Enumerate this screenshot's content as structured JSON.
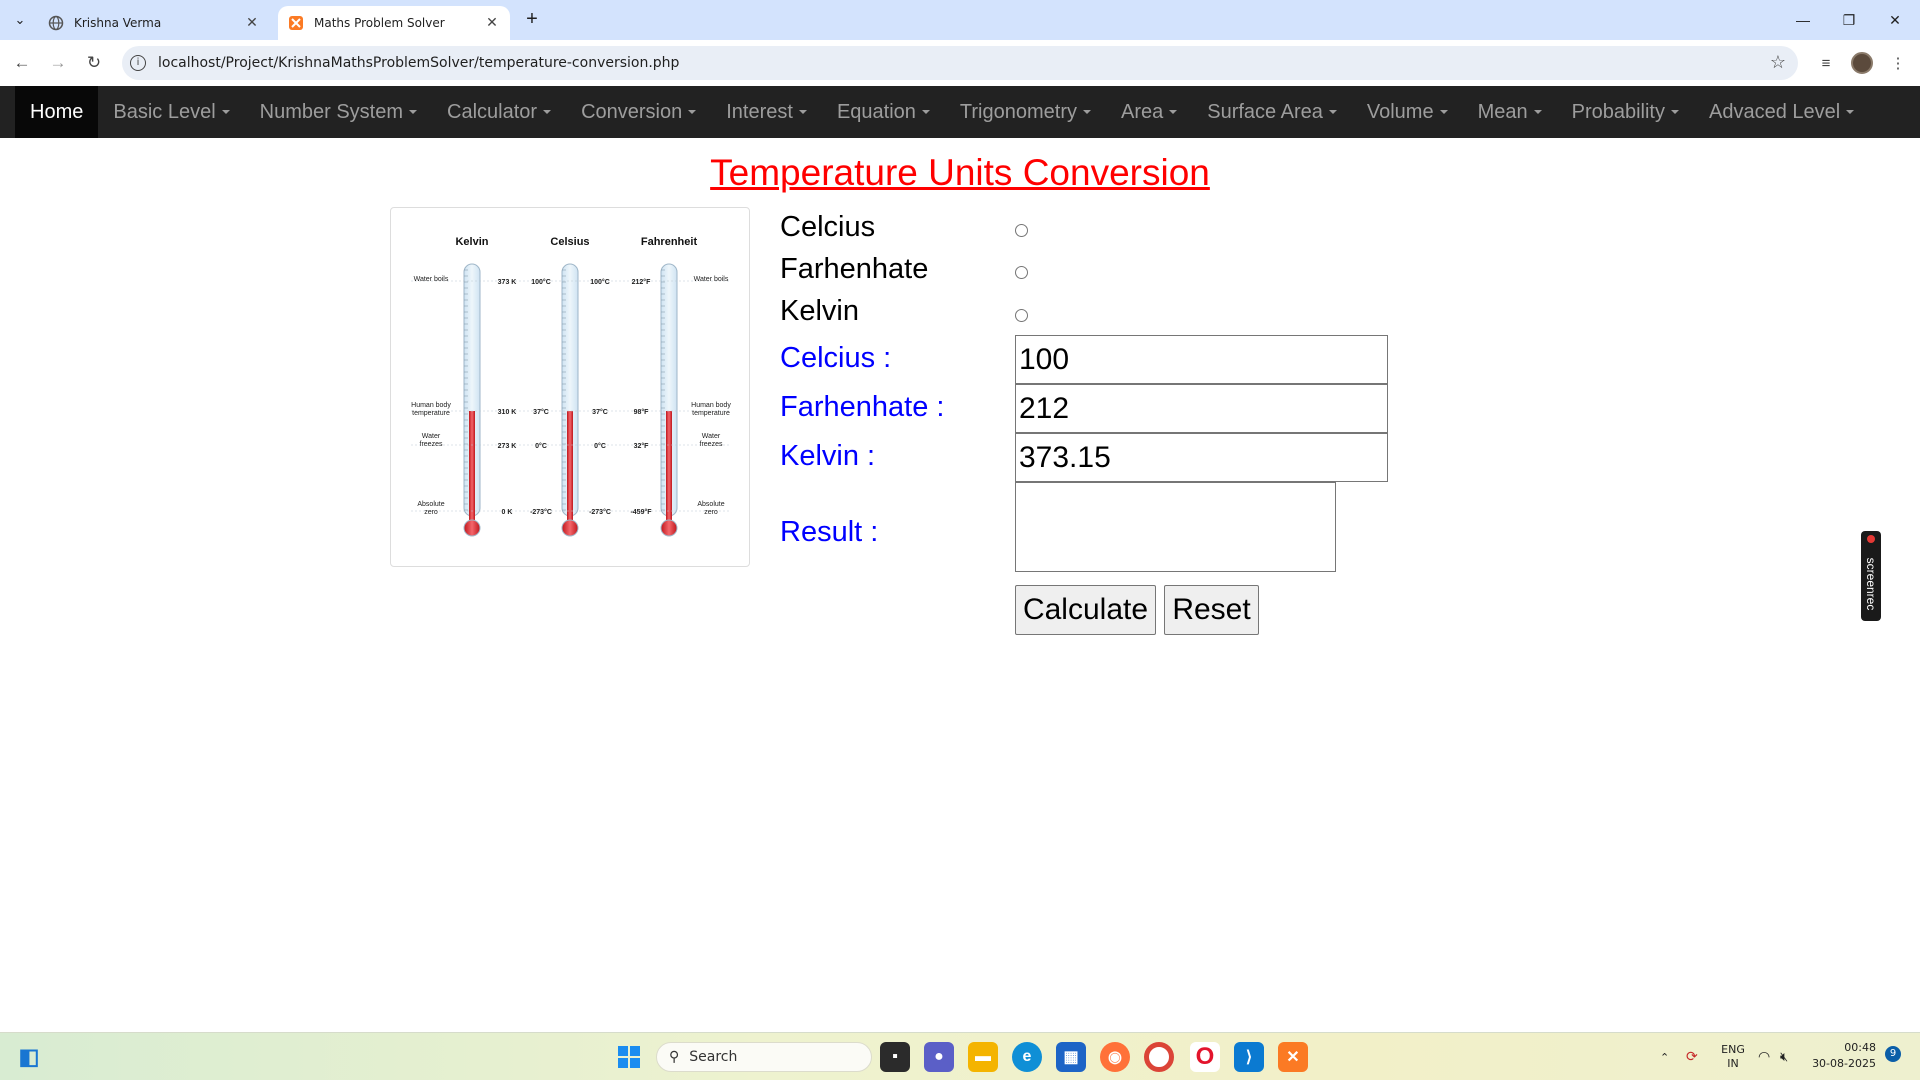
{
  "browser": {
    "tabs": [
      {
        "title": "Krishna Verma",
        "icon": "globe-icon"
      },
      {
        "title": "Maths Problem Solver",
        "icon": "xampp-icon"
      }
    ],
    "url": "localhost/Project/KrishnaMathsProblemSolver/temperature-conversion.php"
  },
  "nav": {
    "items": [
      {
        "label": "Home",
        "caret": false
      },
      {
        "label": "Basic Level",
        "caret": true
      },
      {
        "label": "Number System",
        "caret": true
      },
      {
        "label": "Calculator",
        "caret": true
      },
      {
        "label": "Conversion",
        "caret": true
      },
      {
        "label": "Interest",
        "caret": true
      },
      {
        "label": "Equation",
        "caret": true
      },
      {
        "label": "Trigonometry",
        "caret": true
      },
      {
        "label": "Area",
        "caret": true
      },
      {
        "label": "Surface Area",
        "caret": true
      },
      {
        "label": "Volume",
        "caret": true
      },
      {
        "label": "Mean",
        "caret": true
      },
      {
        "label": "Probability",
        "caret": true
      },
      {
        "label": "Advaced Level",
        "caret": true
      }
    ]
  },
  "page": {
    "title": "Temperature Units Conversion",
    "radio_labels": [
      "Celcius",
      "Farhenhate",
      "Kelvin"
    ],
    "fields": {
      "celsius_label": "Celcius :",
      "celsius_value": "100",
      "fahrenheit_label": "Farhenhate :",
      "fahrenheit_value": "212",
      "kelvin_label": "Kelvin :",
      "kelvin_value": "373.15",
      "result_label": "Result :",
      "result_value": ""
    },
    "buttons": {
      "calculate": "Calculate",
      "reset": "Reset"
    },
    "title_color": "#ff0000",
    "label_color": "#0000ff"
  },
  "thermometer_image": {
    "headers": [
      "Kelvin",
      "Celsius",
      "Fahrenheit"
    ],
    "left_notes": [
      "Water boils",
      "Human body temperature",
      "Water freezes",
      "Absolute zero"
    ],
    "right_notes": [
      "Water boils",
      "Human body temperature",
      "Water freezes",
      "Absolute zero"
    ],
    "kelvin_marks": [
      "373 K",
      "310 K",
      "273 K",
      "0 K"
    ],
    "celsius_left_marks": [
      "100°C",
      "37°C",
      "0°C",
      "-273°C"
    ],
    "celsius_right_marks": [
      "100°C",
      "37°C",
      "0°C",
      "-273°C"
    ],
    "fahrenheit_marks": [
      "212°F",
      "98°F",
      "32°F",
      "-459°F"
    ]
  },
  "overlay": {
    "screenrec_label": "screenrec"
  },
  "taskbar": {
    "search_placeholder": "Search",
    "tray_lang": "ENG",
    "tray_region": "IN",
    "time": "00:48",
    "date": "30-08-2025",
    "notification_count": "9"
  }
}
